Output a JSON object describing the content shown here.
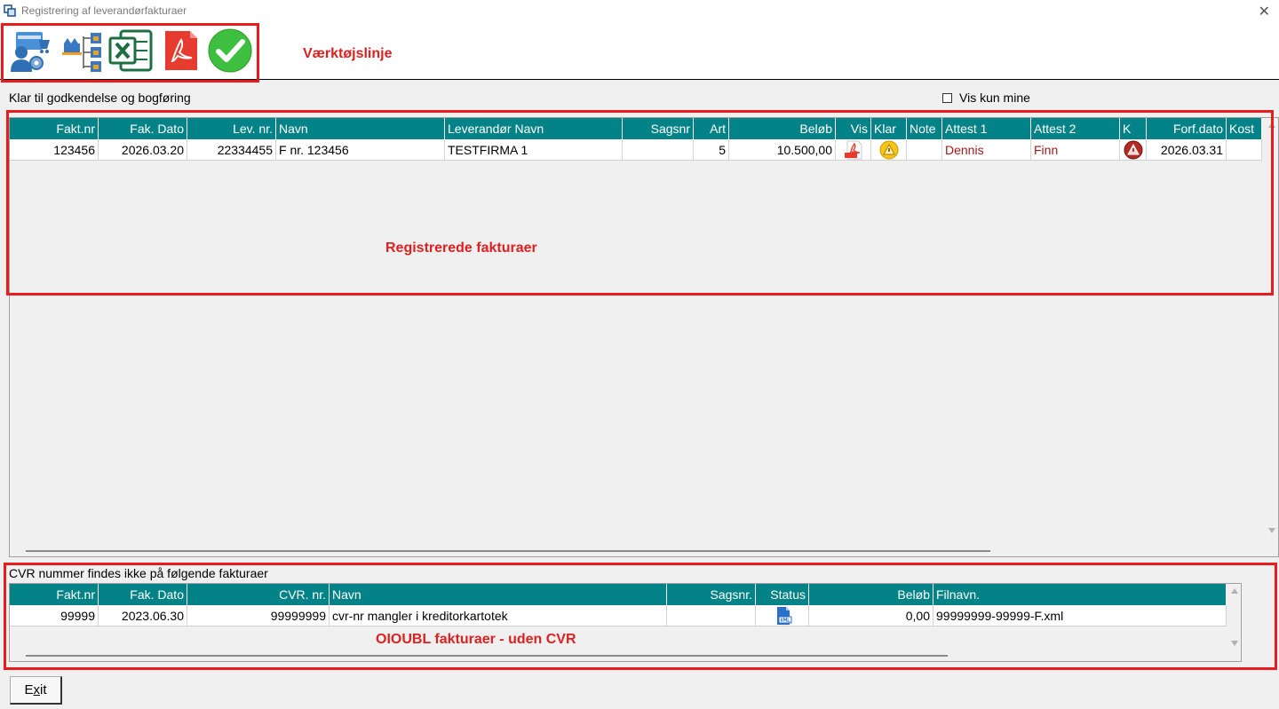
{
  "window": {
    "title": "Registrering af leverandørfakturaer",
    "close_glyph": "✕"
  },
  "toolbar": {
    "label": "Værktøjslinje",
    "buttons": [
      {
        "name": "supplier-settings-icon"
      },
      {
        "name": "workflow-icon"
      },
      {
        "name": "excel-icon"
      },
      {
        "name": "pdf-icon"
      },
      {
        "name": "approve-icon"
      }
    ]
  },
  "section1": {
    "label": "Klar til godkendelse og bogføring",
    "checkbox_label": "Vis kun mine",
    "annotation": "Registrerede fakturaer",
    "columns": [
      "Fakt.nr",
      "Fak. Dato",
      "Lev. nr.",
      "Navn",
      "Leverandør Navn",
      "Sagsnr",
      "Art",
      "Beløb",
      "Vis",
      "Klar",
      "Note",
      "Attest 1",
      "Attest 2",
      "K",
      "Forf.dato",
      "Kost"
    ],
    "rows": [
      {
        "fakt_nr": "123456",
        "fak_dato": "2026.03.20",
        "lev_nr": "22334455",
        "navn": "F nr. 123456",
        "leverandor_navn": "TESTFIRMA 1",
        "sagsnr": "",
        "art": "5",
        "belob": "10.500,00",
        "note": "",
        "attest1": "Dennis",
        "attest2": "Finn",
        "forf_dato": "2026.03.31",
        "kost": ""
      }
    ]
  },
  "section2": {
    "label": "CVR nummer findes ikke på følgende fakturaer",
    "annotation": "OIOUBL fakturaer - uden CVR",
    "columns": [
      "Fakt.nr",
      "Fak. Dato",
      "CVR. nr.",
      "Navn",
      "Sagsnr.",
      "Status",
      "Beløb",
      "Filnavn."
    ],
    "rows": [
      {
        "fakt_nr": "99999",
        "fak_dato": "2023.06.30",
        "cvr_nr": "99999999",
        "navn": "cvr-nr mangler i kreditorkartotek",
        "sagsnr": "",
        "belob": "0,00",
        "filnavn": "99999999-99999-F.xml"
      }
    ]
  },
  "exit_button": {
    "prefix": "E",
    "underlined": "x",
    "suffix": "it"
  },
  "colors": {
    "header_teal": "#038387",
    "annotation_red": "#e81c1c",
    "attest_red": "#9e1a1a"
  }
}
